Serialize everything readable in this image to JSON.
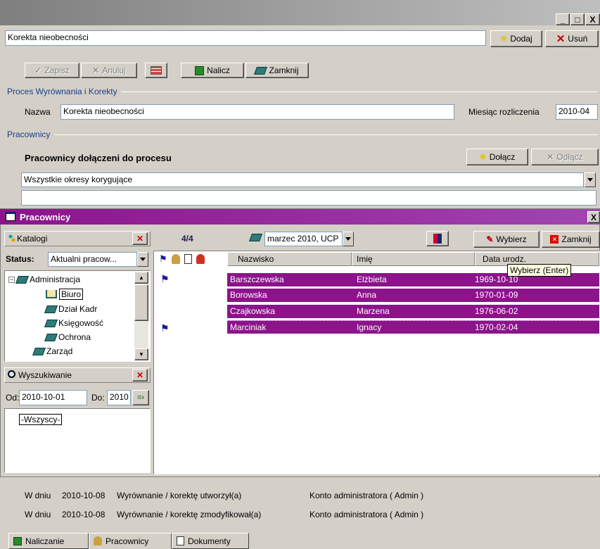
{
  "window": {
    "min_label": "_",
    "max_label": "□",
    "close_label": "X"
  },
  "top_bar": {
    "title_value": "Korekta nieobecności",
    "add_label": "Dodaj",
    "delete_label": "Usuń"
  },
  "toolbar": {
    "save_label": "Zapisz",
    "cancel_label": "Anuluj",
    "calc_label": "Nalicz",
    "close_label": "Zamknij"
  },
  "process": {
    "section_label": "Proces Wyrównania i Korekty",
    "name_label": "Nazwa",
    "name_value": "Korekta nieobecności",
    "month_label": "Miesiąc rozliczenia",
    "month_value": "2010-04"
  },
  "employees": {
    "section_label": "Pracownicy",
    "heading": "Pracownicy dołączeni do procesu",
    "attach_label": "Dołącz",
    "detach_label": "Odłącz",
    "filter_value": "Wszystkie okresy korygujące"
  },
  "dialog": {
    "title": "Pracownicy",
    "close_label": "X",
    "catalogs_label": "Katalogi",
    "status_label": "Status:",
    "status_value": "Aktualni pracow...",
    "count": "4/4",
    "period_value": "marzec 2010, UCP",
    "select_label": "Wybierz",
    "close_btn_label": "Zamknij",
    "tooltip": "Wybierz (Enter)",
    "tree": [
      "Administracja",
      "Biuro",
      "Dział Kadr",
      "Księgowość",
      "Ochrona",
      "Zarząd"
    ],
    "search_label": "Wyszukiwanie",
    "from_label": "Od:",
    "from_value": "2010-10-01",
    "to_label": "Do:",
    "to_value": "2010",
    "all_label": "-Wszyscy-",
    "columns": [
      "Nazwisko",
      "Imię",
      "Data urodz."
    ],
    "rows": [
      {
        "last": "Barszczewska",
        "first": "Elżbieta",
        "date": "1969-10-10"
      },
      {
        "last": "Borowska",
        "first": "Anna",
        "date": "1970-01-09"
      },
      {
        "last": "Czajkowska",
        "first": "Marzena",
        "date": "1976-06-02"
      },
      {
        "last": "Marciniak",
        "first": "Ignacy",
        "date": "1970-02-04"
      }
    ]
  },
  "footer": {
    "created": {
      "prefix": "W dniu",
      "date": "2010-10-08",
      "text": "Wyrównanie / korektę utworzył(a)",
      "user": "Konto administratora ( Admin )"
    },
    "modified": {
      "prefix": "W dniu",
      "date": "2010-10-08",
      "text": "Wyrównanie / korektę zmodyfikował(a)",
      "user": "Konto administratora ( Admin )"
    }
  },
  "tabs": [
    "Naliczanie",
    "Pracownicy",
    "Dokumenty"
  ],
  "colors": {
    "title_gradient_start": "#8b148b",
    "row_highlight": "#8b148b",
    "section_blue": "#1a3d8c"
  }
}
